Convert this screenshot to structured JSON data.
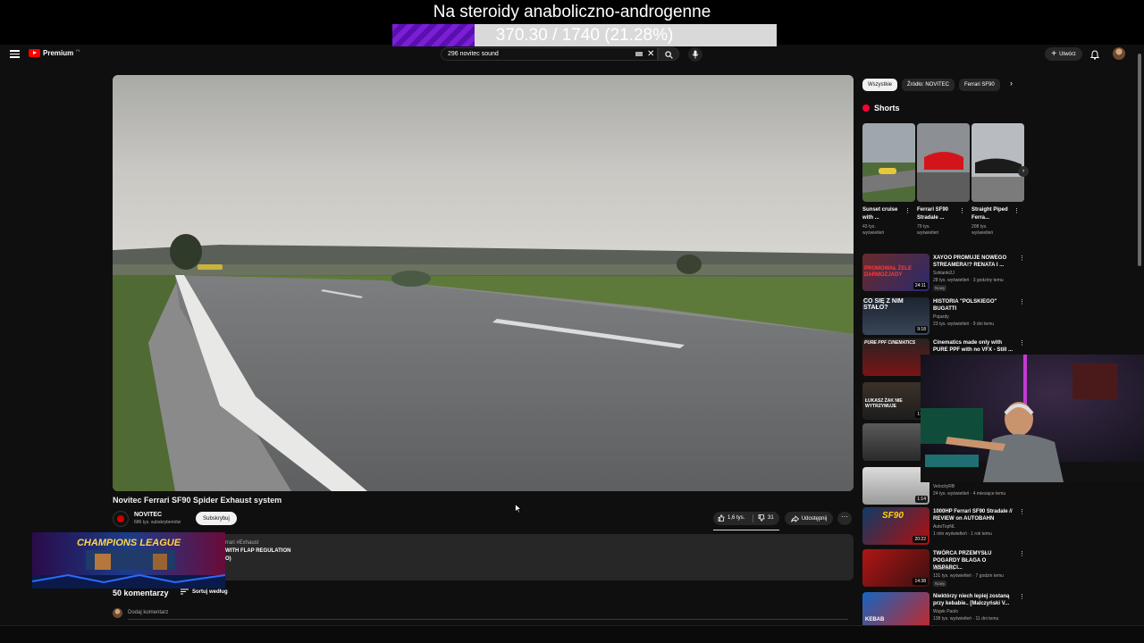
{
  "overlay": {
    "title": "Na steroidy anaboliczno-androgenne",
    "progress_text": "370.30 / 1740 (21.28%)",
    "progress_fraction": 0.2128,
    "progress_color": "#7a1fd6"
  },
  "header": {
    "logo_text": "Premium",
    "logo_region": "PL",
    "search_value": "296 novitec sound",
    "create_label": "Utwórz",
    "icons": [
      "menu-icon",
      "search-icon",
      "mic-icon",
      "bell-icon",
      "keyboard-icon",
      "close-icon"
    ]
  },
  "video": {
    "title": "Novitec Ferrari SF90 Spider Exhaust system",
    "channel": "NOVITEC",
    "subscribers": "686 tys. subskrybentów",
    "subscribe_label": "Subskrybuj",
    "likes": "1,6 tys.",
    "dislikes": "31",
    "share_label": "Udostępnij",
    "more_label": "···"
  },
  "description": {
    "line1": "rrari #Exhaust",
    "line2": "WITH FLAP REGULATION",
    "line3": "O)"
  },
  "comments": {
    "count": "50 komentarzy",
    "sort_label": "Sortuj według",
    "add_placeholder": "Dodaj komentarz"
  },
  "sidebar": {
    "chips": [
      "Wszystkie",
      "Źródło: NOVITEC",
      "Ferrari SF90"
    ],
    "shorts_title": "Shorts",
    "shorts": [
      {
        "title": "Sunset cruise with ...",
        "views": "43 tys. wyświetleń"
      },
      {
        "title": "Ferrari SF90 Stradale ...",
        "views": "79 tys. wyświetleń"
      },
      {
        "title": "Straight Piped Ferra...",
        "views": "208 tys. wyświetleń"
      }
    ],
    "recommended": [
      {
        "title": "XAYOO PROMUJE NOWEGO STREAMERA!? RENATA I ...",
        "channel": "Szklanki2J",
        "meta": "28 tys. wyświetleń · 3 godziny temu",
        "badge": "Nowy",
        "duration": "24:11",
        "thumb_text": "PROMOWAŁ ŻELE DARMOZJADY"
      },
      {
        "title": "HISTORIA \"POLSKIEGO\" BUGATTI",
        "channel": "Pojazdy",
        "meta": "23 tys. wyświetleń · 9 dni temu",
        "badge": "",
        "duration": "9:18",
        "thumb_text": "CO SIĘ Z NIM STAŁO?"
      },
      {
        "title": "Cinematics made only with PURE PPF with no VFX - Still ...",
        "channel": "",
        "meta": "",
        "badge": "",
        "duration": "",
        "thumb_text": "PURE PPF CINEMATICS"
      },
      {
        "title": "",
        "channel": "",
        "meta": "",
        "badge": "",
        "duration": "1:22",
        "thumb_text": "ŁUKASZ ŻAK NIE WYTRZYMUJE"
      },
      {
        "title": "",
        "channel": "",
        "meta": "",
        "badge": "",
        "duration": "",
        "thumb_text": ""
      },
      {
        "title": "",
        "channel": "VelocityRB",
        "meta": "24 tys. wyświetleń · 4 miesiące temu",
        "badge": "",
        "duration": "1:14",
        "thumb_text": ""
      },
      {
        "title": "1000HP Ferrari SF90 Stradale // REVIEW on AUTOBAHN",
        "channel": "AutoTopNL",
        "meta": "1 mln wyświetleń · 1 rok temu",
        "badge": "",
        "duration": "20:22",
        "thumb_text": "SF90"
      },
      {
        "title": "TWÓRCA PRZEMYSŁU POGARDY BŁAGA O WSPARCI...",
        "channel": "Kanał Zero",
        "meta": "131 tys. wyświetleń · 7 godzin temu",
        "badge": "Nowy",
        "duration": "14:38",
        "thumb_text": ""
      },
      {
        "title": "Niektórzy niech lepiej zostaną przy kebabie.. [Malczyński V...",
        "channel": "Wujek Paolo",
        "meta": "138 tys. wyświetleń · 11 dni temu",
        "badge": "",
        "duration": "",
        "thumb_text": "KEBAB"
      }
    ]
  },
  "game_cam_text": "CHAMPIONS LEAGUE",
  "colors": {
    "accent": "#ff0000",
    "background": "#0f0f0f",
    "chip": "#272727"
  }
}
